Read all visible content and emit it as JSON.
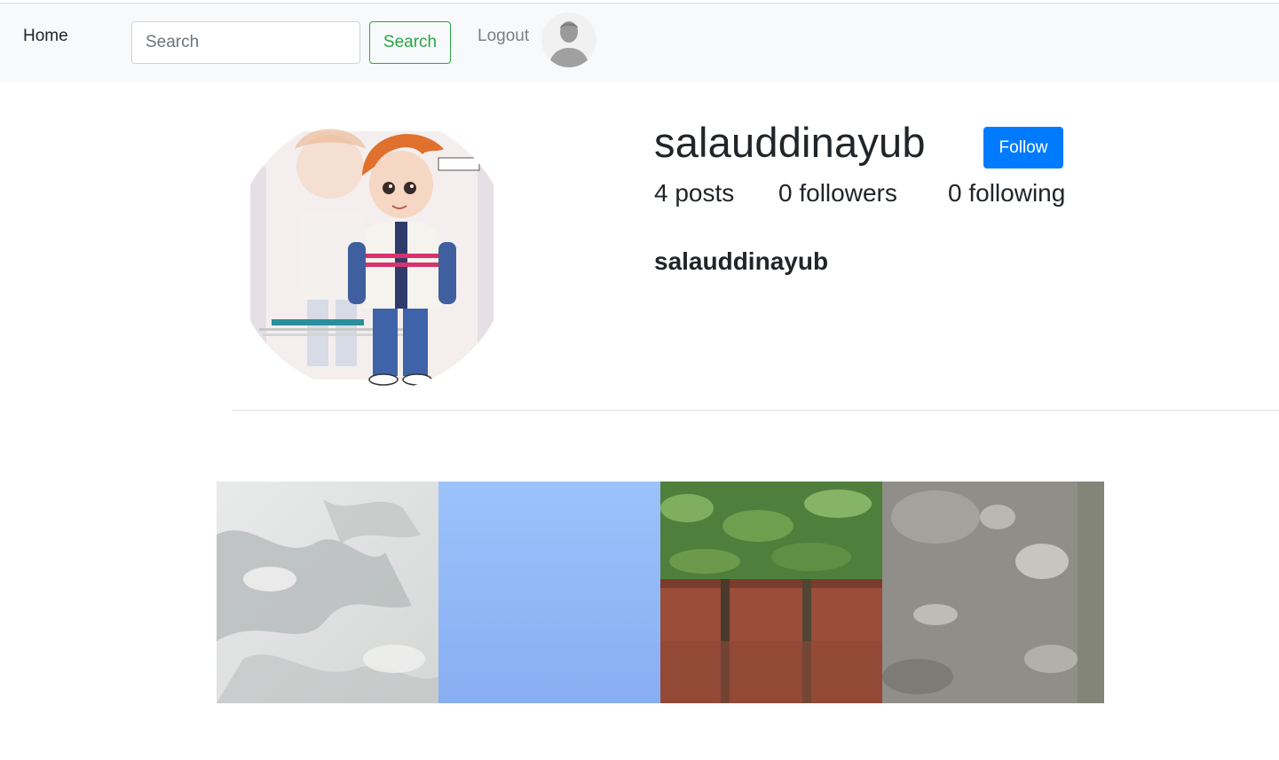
{
  "nav": {
    "home_label": "Home",
    "search_placeholder": "Search",
    "search_value": "",
    "search_button": "Search",
    "logout_label": "Logout"
  },
  "profile": {
    "username": "salauddinayub",
    "follow_label": "Follow",
    "posts": "4 posts",
    "followers": "0 followers",
    "following": "0 following",
    "display_name": "salauddinayub"
  },
  "colors": {
    "navbar_bg": "#f8f9fa",
    "success": "#28a745",
    "primary": "#007bff"
  },
  "icons": {
    "nav_avatar": "default-user-avatar-icon",
    "profile_picture": "cartoon-boy-profile-picture"
  },
  "posts": [
    {
      "description": "grey leaf shadows"
    },
    {
      "description": "blue sky"
    },
    {
      "description": "green grass and red wall"
    },
    {
      "description": "grey textured ground with light spots"
    }
  ]
}
